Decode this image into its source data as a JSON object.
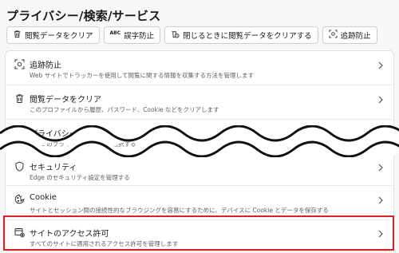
{
  "page": {
    "title": "プライバシー/検索/サービス"
  },
  "chips": [
    {
      "label": "閲覧データをクリア",
      "icon": "trash-icon"
    },
    {
      "label": "誤字防止",
      "icon": "abc-spellcheck-icon",
      "icon_text": "ABC"
    },
    {
      "label": "閉じるときに閲覧データをクリアする",
      "icon": "trash-clock-icon"
    },
    {
      "label": "追跡防止",
      "icon": "tracking-prevention-icon"
    }
  ],
  "items": [
    {
      "title": "追跡防止",
      "desc": "Web サイトでトラッカーを使用して閲覧に関する情報を収集する方法を管理します",
      "icon": "tracking-prevention-icon"
    },
    {
      "title": "閲覧データをクリア",
      "desc": "このプロファイルから履歴、パスワード、Cookie などをクリアします",
      "icon": "trash-icon"
    },
    {
      "title": "プライバシー",
      "desc": "Edge のプライバシーの設定を選択する",
      "icon": "spy-glasses-icon"
    },
    {
      "title": "セキュリティ",
      "desc": "Edge のセキュリティ設定を管理する",
      "icon": "shield-icon"
    },
    {
      "title": "Cookie",
      "desc": "サイトとセッション間の接続性的なブラウジングを容易にするために、デバイスに Cookie とデータを保存する",
      "icon": "cookie-icon"
    },
    {
      "title": "サイトのアクセス許可",
      "desc": "すべてのサイトに適用されるアクセス許可を管理します",
      "icon": "site-permissions-icon"
    }
  ],
  "colors": {
    "highlight": "#d92126",
    "background": "#f7f7f7",
    "card": "#ffffff"
  }
}
